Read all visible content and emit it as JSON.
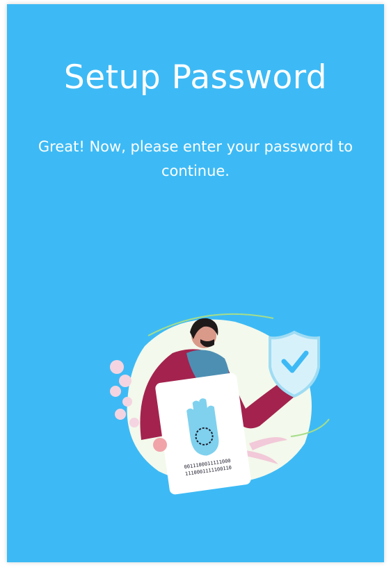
{
  "page": {
    "title": "Setup Password",
    "subtitle": "Great! Now, please enter your password to continue.",
    "background_color": "#3dbaf5"
  },
  "illustration": {
    "icon": "biometric-security-illustration",
    "card_code_line1": "0011100011111000",
    "card_code_line2": "1110001111100110"
  }
}
